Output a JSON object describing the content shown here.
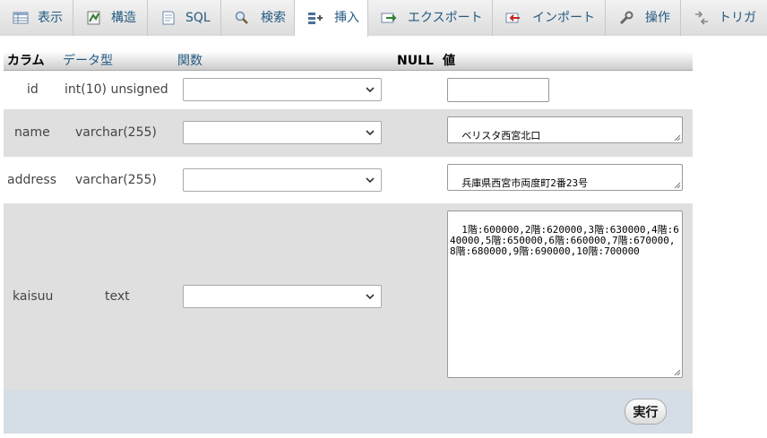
{
  "tabs": [
    {
      "label": "表示",
      "icon": "table-icon"
    },
    {
      "label": "構造",
      "icon": "structure-icon"
    },
    {
      "label": "SQL",
      "icon": "sql-icon"
    },
    {
      "label": "検索",
      "icon": "search-icon"
    },
    {
      "label": "挿入",
      "icon": "insert-icon",
      "active": true
    },
    {
      "label": "エクスポート",
      "icon": "export-icon"
    },
    {
      "label": "インポート",
      "icon": "import-icon"
    },
    {
      "label": "操作",
      "icon": "wrench-icon"
    },
    {
      "label": "トリガ",
      "icon": "trigger-icon"
    }
  ],
  "table": {
    "headers": {
      "column": "カラム",
      "type": "データ型",
      "function": "関数",
      "null": "NULL",
      "value": "値"
    },
    "rows": [
      {
        "column": "id",
        "type": "int(10) unsigned",
        "function": "",
        "value": ""
      },
      {
        "column": "name",
        "type": "varchar(255)",
        "function": "",
        "value": "ベリスタ西宮北口"
      },
      {
        "column": "address",
        "type": "varchar(255)",
        "function": "",
        "value": "兵庫県西宮市両度町2番23号"
      },
      {
        "column": "kaisuu",
        "type": "text",
        "function": "",
        "value": "1階:600000,2階:620000,3階:630000,4階:640000,5階:650000,6階:660000,7階:670000,8階:680000,9階:690000,10階:700000"
      }
    ]
  },
  "footer": {
    "submit_label": "実行"
  },
  "colors": {
    "link": "#235a81",
    "row_alt": "#dfdfdf",
    "footer": "#d5dde6"
  }
}
